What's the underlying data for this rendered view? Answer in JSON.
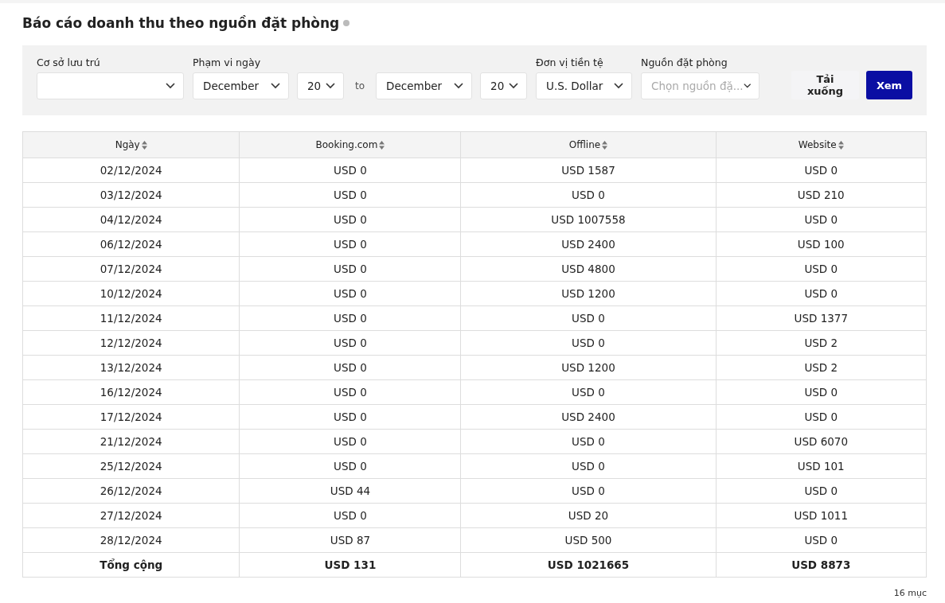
{
  "title": "Báo cáo doanh thu theo nguồn đặt phòng",
  "filters": [
    {
      "label": "Cơ sở lưu trú",
      "items": [
        {
          "kind": "select",
          "value": ""
        }
      ]
    },
    {
      "label": "Phạm vi ngày",
      "items": [
        {
          "kind": "select",
          "value": "December"
        },
        {
          "kind": "select",
          "value": "20"
        },
        {
          "kind": "text",
          "value": "to"
        },
        {
          "kind": "select",
          "value": "December"
        },
        {
          "kind": "select",
          "value": "20"
        }
      ]
    },
    {
      "label": "Đơn vị tiền tệ",
      "items": [
        {
          "kind": "select",
          "value": "U.S. Dollar"
        }
      ]
    },
    {
      "label": "Nguồn đặt phòng",
      "items": [
        {
          "kind": "select",
          "placeholder": "Chọn nguồn đặ..."
        }
      ]
    }
  ],
  "buttons": [
    {
      "label": "Tải xuống",
      "kind": "secondary"
    },
    {
      "label": "Xem",
      "kind": "primary"
    }
  ],
  "table": {
    "columns": [
      "Ngày",
      "Booking.com",
      "Offline",
      "Website"
    ],
    "rows": [
      [
        "02/12/2024",
        "USD 0",
        "USD 1587",
        "USD 0"
      ],
      [
        "03/12/2024",
        "USD 0",
        "USD 0",
        "USD 210"
      ],
      [
        "04/12/2024",
        "USD 0",
        "USD 1007558",
        "USD 0"
      ],
      [
        "06/12/2024",
        "USD 0",
        "USD 2400",
        "USD 100"
      ],
      [
        "07/12/2024",
        "USD 0",
        "USD 4800",
        "USD 0"
      ],
      [
        "10/12/2024",
        "USD 0",
        "USD 1200",
        "USD 0"
      ],
      [
        "11/12/2024",
        "USD 0",
        "USD 0",
        "USD 1377"
      ],
      [
        "12/12/2024",
        "USD 0",
        "USD 0",
        "USD 2"
      ],
      [
        "13/12/2024",
        "USD 0",
        "USD 1200",
        "USD 2"
      ],
      [
        "16/12/2024",
        "USD 0",
        "USD 0",
        "USD 0"
      ],
      [
        "17/12/2024",
        "USD 0",
        "USD 2400",
        "USD 0"
      ],
      [
        "21/12/2024",
        "USD 0",
        "USD 0",
        "USD 6070"
      ],
      [
        "25/12/2024",
        "USD 0",
        "USD 0",
        "USD 101"
      ],
      [
        "26/12/2024",
        "USD 44",
        "USD 0",
        "USD 0"
      ],
      [
        "27/12/2024",
        "USD 0",
        "USD 20",
        "USD 1011"
      ],
      [
        "28/12/2024",
        "USD 87",
        "USD 500",
        "USD 0"
      ]
    ],
    "total": [
      "Tổng cộng",
      "USD 131",
      "USD 1021665",
      "USD 8873"
    ]
  },
  "footer": "16 mục"
}
